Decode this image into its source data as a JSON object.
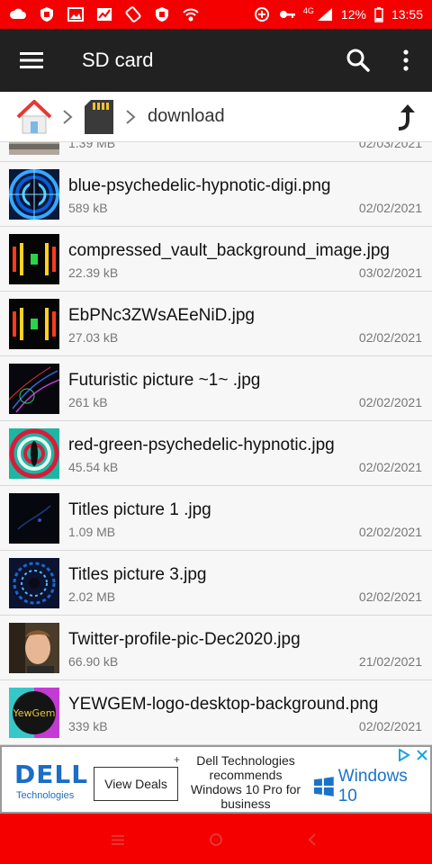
{
  "status_bar": {
    "network": "4G",
    "battery": "12%",
    "time": "13:55",
    "color": "#f40000"
  },
  "app_bar": {
    "title": "SD card",
    "background": "#212121"
  },
  "breadcrumb": {
    "current_folder": "download"
  },
  "files": [
    {
      "name": "",
      "size": "1.39 MB",
      "date": "02/03/2021",
      "thumb": "thumb-landscape"
    },
    {
      "name": "blue-psychedelic-hypnotic-digi.png",
      "size": "589 kB",
      "date": "02/02/2021",
      "thumb": "thumb-blue-psychedelic"
    },
    {
      "name": "compressed_vault_background_image.jpg",
      "size": "22.39 kB",
      "date": "03/02/2021",
      "thumb": "thumb-vault"
    },
    {
      "name": "EbPNc3ZWsAEeNiD.jpg",
      "size": "27.03 kB",
      "date": "02/02/2021",
      "thumb": "thumb-vault"
    },
    {
      "name": "Futuristic picture ~1~ .jpg",
      "size": "261 kB",
      "date": "02/02/2021",
      "thumb": "thumb-futuristic"
    },
    {
      "name": "red-green-psychedelic-hypnotic.jpg",
      "size": "45.54 kB",
      "date": "02/02/2021",
      "thumb": "thumb-red-green"
    },
    {
      "name": "Titles picture 1 .jpg",
      "size": "1.09 MB",
      "date": "02/02/2021",
      "thumb": "thumb-dark"
    },
    {
      "name": "Titles picture 3.jpg",
      "size": "2.02 MB",
      "date": "02/02/2021",
      "thumb": "thumb-blue-swirl"
    },
    {
      "name": "Twitter-profile-pic-Dec2020.jpg",
      "size": "66.90 kB",
      "date": "21/02/2021",
      "thumb": "thumb-portrait"
    },
    {
      "name": "YEWGEM-logo-desktop-background.png",
      "size": "339 kB",
      "date": "02/02/2021",
      "thumb": "thumb-yewgem"
    }
  ],
  "thumb_texts": {
    "yewgem": "YewGem"
  },
  "ad": {
    "brand": "DELL",
    "brand_sub": "Technologies",
    "button_label": "View Deals",
    "plus": "+",
    "text": "Dell Technologies recommends Windows 10 Pro for business",
    "product": "Windows 10"
  }
}
